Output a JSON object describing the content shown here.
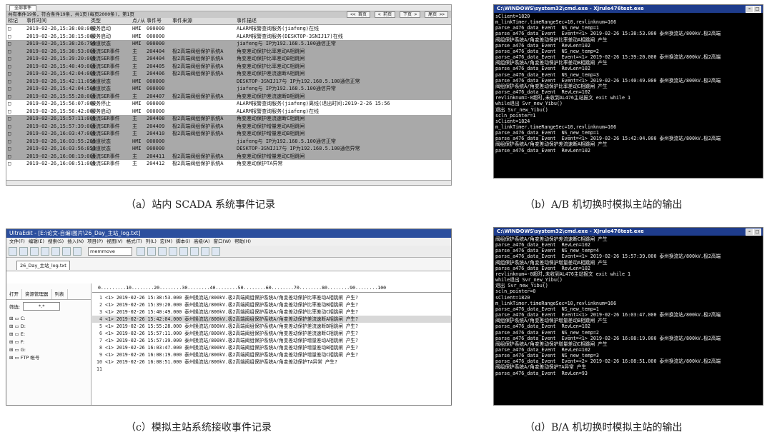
{
  "panel_a": {
    "tab": "全部事件",
    "summary": "共有事件19条，符合条件19条，共1页(每页2000条)，第1页",
    "pager": [
      "<< 首页",
      "< 前页",
      "下页 >",
      "尾页 >>"
    ],
    "headers": [
      "标记",
      "事件时间",
      "类型",
      "点/从",
      "事件号",
      "事件来源",
      "事件描述"
    ],
    "rows": [
      {
        "shade": "light",
        "cells": [
          "□",
          "2019-02-26,15:38:08:000",
          "服务启动",
          "HMI",
          "000000",
          "",
          "ALARM报警查询服务(jiafeng)在线"
        ]
      },
      {
        "shade": "light",
        "cells": [
          "□",
          "2019-02-26,15:38:15:000",
          "服务启动",
          "HMI",
          "000000",
          "",
          "ALARM报警查询服务(DESKTOP-3SNIJ17)在线"
        ]
      },
      {
        "shade": "dark",
        "cells": [
          "□",
          "2019-02-26,15:38:26:799",
          "通道状态",
          "HMI",
          "000000",
          "",
          "jiafeng与 IP为192.168.5.100通信正常"
        ]
      },
      {
        "shade": "dark",
        "cells": [
          "□",
          "2019-02-26,15:38:53:000",
          "直流SER事件",
          "主",
          "204404",
          "极2高端阀组保护系统A",
          "角变差动保护比率差动A相跳闸"
        ]
      },
      {
        "shade": "dark",
        "cells": [
          "□",
          "2019-02-26,15:39:20:000",
          "直流SER事件",
          "主",
          "204404",
          "极2高端阀组保护系统A",
          "角变差动保护比率差动B相跳闸"
        ]
      },
      {
        "shade": "dark",
        "cells": [
          "□",
          "2019-02-26,15:40:49:000",
          "直流SER事件",
          "主",
          "204405",
          "极2高端阀组保护系统A",
          "角变差动保护比率差动C相跳闸"
        ]
      },
      {
        "shade": "dark",
        "cells": [
          "□",
          "2019-02-26,15:42:04:000",
          "直流SER事件",
          "主",
          "204406",
          "极2高端阀组保护系统A",
          "角变差动保护差流速断A相跳闸"
        ]
      },
      {
        "shade": "dark",
        "cells": [
          "□",
          "2019-02-26,15:42:11:056",
          "通道状态",
          "HMI",
          "000000",
          "",
          "DESKTOP-3SNIJ17与 IP为192.168.5.100通信正常"
        ]
      },
      {
        "shade": "dark",
        "cells": [
          "□",
          "2019-02-26,15:42:04:568",
          "通道状态",
          "HMI",
          "000000",
          "",
          "jiafeng与 IP为192.168.5.100通信异常"
        ]
      },
      {
        "shade": "dark",
        "cells": [
          "□",
          "2019-02-26,15:55:28:000",
          "直流SER事件",
          "主",
          "204407",
          "极2高端阀组保护系统A",
          "角变差动保护差流速断B相跳闸"
        ]
      },
      {
        "shade": "light",
        "cells": [
          "□",
          "2019-02-26,15:56:07:000",
          "服务停止",
          "HMI",
          "000000",
          "",
          "ALARM报警查询服务(jiafeng)离线(退出时间:2019-2-26 15:56"
        ]
      },
      {
        "shade": "light",
        "cells": [
          "□",
          "2019-02-26,15:56:42:000",
          "服务启动",
          "HMI",
          "000000",
          "",
          "ALARM报警查询服务(jiafeng)在线"
        ]
      },
      {
        "shade": "dark",
        "cells": [
          "□",
          "2019-02-26,15:57:11:000",
          "直流SER事件",
          "主",
          "204408",
          "极2高端阀组保护系统A",
          "角变差动保护差流速断C相跳闸"
        ]
      },
      {
        "shade": "dark",
        "cells": [
          "□",
          "2019-02-26,15:57:39:000",
          "直流SER事件",
          "主",
          "204409",
          "极2高端阀组保护系统A",
          "角变差动保护增量差动A相跳闸"
        ]
      },
      {
        "shade": "dark",
        "cells": [
          "□",
          "2019-02-26,16:03:47:000",
          "直流SER事件",
          "主",
          "204410",
          "极2高端阀组保护系统A",
          "角变差动保护增量差动B相跳闸"
        ]
      },
      {
        "shade": "dark",
        "cells": [
          "□",
          "2019-02-26,16:03:55:285",
          "通道状态",
          "HMI",
          "000000",
          "",
          "jiafeng与 IP为192.168.5.100通信正常"
        ]
      },
      {
        "shade": "dark",
        "cells": [
          "□",
          "2019-02-26,16:03:56:853",
          "通道状态",
          "HMI",
          "000000",
          "",
          "DESKTOP-3SNIJ17与 IP为192.168.5.100通信异常"
        ]
      },
      {
        "shade": "dark",
        "cells": [
          "□",
          "2019-02-26,16:08:19:000",
          "直流SER事件",
          "主",
          "204411",
          "极2高端阀组保护系统A",
          "角变差动保护增量差动C相跳闸"
        ]
      },
      {
        "shade": "light",
        "cells": [
          "□",
          "2019-02-26,16:08:51:000",
          "直流SER事件",
          "主",
          "204412",
          "极2高端阀组保护系统A",
          "角变差动保护TA异常"
        ]
      }
    ]
  },
  "panel_b": {
    "title": "C:\\WINDOWS\\system32\\cmd.exe - XJrule476test.exe",
    "lines": [
      "sClient=1820",
      "m_linkTimer.timeRangeSec=10,revlinknum=166",
      "parse_a476_data_Event  NS_new_temp=1",
      "parse_a476_data_Event  Event=<1> 2019-02-26 15:38:53.000 泰州换流站/800kV.极2高端",
      "阀组保护系统A/角变差动保护比率差动A相跳闸 产生",
      "parse_a476_data_Event  RevLen=102",
      "parse_a476_data_Event  NS_new_temp=2",
      "parse_a476_data_Event  Event=<1> 2019-02-26 15:39:20.000 泰州换流站/800kV.极2高端",
      "阀组保护系统A/角变差动保护比率差动B相跳闸 产生",
      "parse_a476_data_Event  RevLen=102",
      "parse_a476_data_Event  NS_new_temp=3",
      "parse_a476_data_Event  Event=<1> 2019-02-26 15:40:49.000 泰州换流站/800kV.极2高端",
      "阀组保护系统A/角变差动保护比率差动C相跳闸 产生",
      "parse_a476_data_Event  RevLen=102",
      "revlinknum=-0超时,未收到AL476主站报文 exit while 1",
      "while退出 Svr_new_Yibu()",
      "退出 Svr_new_Yibu()",
      "scln_pointer=1",
      "sClient=1824",
      "m_linkTimer.timeRangeSec=10,revlinknum=166",
      "parse_a476_data_Event  NS_new_temp=1",
      "parse_a476_data_Event  Event=<1> 2019-02-26 15:42:04.000 泰州换流站/800kV.极2高端",
      "阀组保护系统A/角变差动保护差流速断A相跳闸 产生",
      "parse_a476_data_Event  RevLen=102"
    ]
  },
  "panel_c": {
    "title": "UltraEdit - [E:\\论文-自编\\图片\\26_Day_主站_log.txt]",
    "menu": [
      "文件(F)",
      "编辑(E)",
      "搜索(S)",
      "插入(N)",
      "项目(P)",
      "视图(V)",
      "格式(T)",
      "列(L)",
      "宏(M)",
      "脚本(i)",
      "高级(A)",
      "窗口(W)",
      "帮助(H)"
    ],
    "combo": "memmove",
    "file_tab": "26_Day_主站_log.txt",
    "side_tabs": [
      "打开",
      "资源管理器",
      "列表"
    ],
    "filter_label": "筛选:",
    "filter_value": "*.*",
    "drives": [
      "C:",
      "D:",
      "E:",
      "F:",
      "G:",
      "FTP 帐号"
    ],
    "ruler": "0.........10........20........30........40........50........60........70........80........90........100",
    "lines": [
      {
        "n": "1",
        "t": "<1> 2019-02-26 15:38:53.000 泰州换流站/800kV.极2高端阀组保护系统A/角变差动保护比率差动A相跳闸 产生?",
        "hl": false
      },
      {
        "n": "2",
        "t": "<1> 2019-02-26 15:39:20.000 泰州换流站/800kV.极2高端阀组保护系统A/角变差动保护比率差动B相跳闸 产生?",
        "hl": false
      },
      {
        "n": "3",
        "t": "<1> 2019-02-26 15:40:49.000 泰州换流站/800kV.极2高端阀组保护系统A/角变差动保护比率差动C相跳闸 产生?",
        "hl": false
      },
      {
        "n": "4",
        "t": "<1> 2019-02-26 15:42:04.000 泰州换流站/800kV.极2高端阀组保护系统A/角变差动保护差流速断A相跳闸 产生?",
        "hl": true
      },
      {
        "n": "5",
        "t": "<1> 2019-02-26 15:55:28.000 泰州换流站/800kV.极2高端阀组保护系统A/角变差动保护差流速断B相跳闸 产生?",
        "hl": false
      },
      {
        "n": "6",
        "t": "<1> 2019-02-26 15:57:11.000 泰州换流站/800kV.极2高端阀组保护系统A/角变差动保护差流速断C相跳闸 产生?",
        "hl": false
      },
      {
        "n": "7",
        "t": "<1> 2019-02-26 15:57:39.000 泰州换流站/800kV.极2高端阀组保护系统A/角变差动保护增量差动A相跳闸 产生?",
        "hl": false
      },
      {
        "n": "8",
        "t": "<1> 2019-02-26 16:03:47.000 泰州换流站/800kV.极2高端阀组保护系统A/角变差动保护增量差动B相跳闸 产生?",
        "hl": false
      },
      {
        "n": "9",
        "t": "<1> 2019-02-26 16:08:19.000 泰州换流站/800kV.极2高端阀组保护系统A/角变差动保护增量差动C相跳闸 产生?",
        "hl": false
      },
      {
        "n": "10",
        "t": "<1> 2019-02-26 16:08:51.000 泰州换流站/800kV.极2高端阀组保护系统A/角变差动保护TA异常 产生?",
        "hl": false
      },
      {
        "n": "11",
        "t": "",
        "hl": false
      }
    ]
  },
  "panel_d": {
    "title": "C:\\WINDOWS\\system32\\cmd.exe - XJrule476test.exe",
    "lines": [
      "阀组保护系统A/角变差动保护差流速断C相跳闸 产生",
      "parse_a476_data_Event  RevLen=102",
      "parse_a476_data_Event  NS_new_temp=4",
      "parse_a476_data_Event  Event=<1> 2019-02-26 15:57:39.000 泰州换流站/800kV.极2高端",
      "阀组保护系统A/角变差动保护增量差动A相跳闸 产生",
      "parse_a476_data_Event  RevLen=102",
      "revlinknum=-0超时,未收到AL476主站报文 exit while 1",
      "while退出 Svr_new_Yibu()",
      "退出 Svr_new_Yibu()",
      "scln_pointer=0",
      "sClient=1820",
      "m_linkTimer.timeRangeSec=10,revlinknum=166",
      "parse_a476_data_Event  NS_new_temp=1",
      "parse_a476_data_Event  Event=<1> 2019-02-26 16:03:47.000 泰州换流站/800kV.极2高端",
      "阀组保护系统A/角变差动保护增量差动B相跳闸 产生",
      "parse_a476_data_Event  RevLen=102",
      "parse_a476_data_Event  NS_new_temp=2",
      "parse_a476_data_Event  Event=<1> 2019-02-26 16:08:19.000 泰州换流站/800kV.极2高端",
      "阀组保护系统A/角变差动保护增量差动C相跳闸 产生",
      "parse_a476_data_Event  RevLen=102",
      "parse_a476_data_Event  NS_new_temp=3",
      "parse_a476_data_Event  Event=<2> 2019-02-26 16:08:51.000 泰州换流站/800kV.极2高端",
      "阀组保护系统A/角变差动保护TA异常 产生",
      "parse_a476_data_Event  RevLen=93"
    ]
  },
  "captions": {
    "a": "（a）站内 SCADA 系统事件记录",
    "b": "（b）A/B 机切换时模拟主站的输出",
    "c": "（c）模拟主站系统接收事件记录",
    "d": "（d）B/A 机切换时模拟主站的输出"
  }
}
